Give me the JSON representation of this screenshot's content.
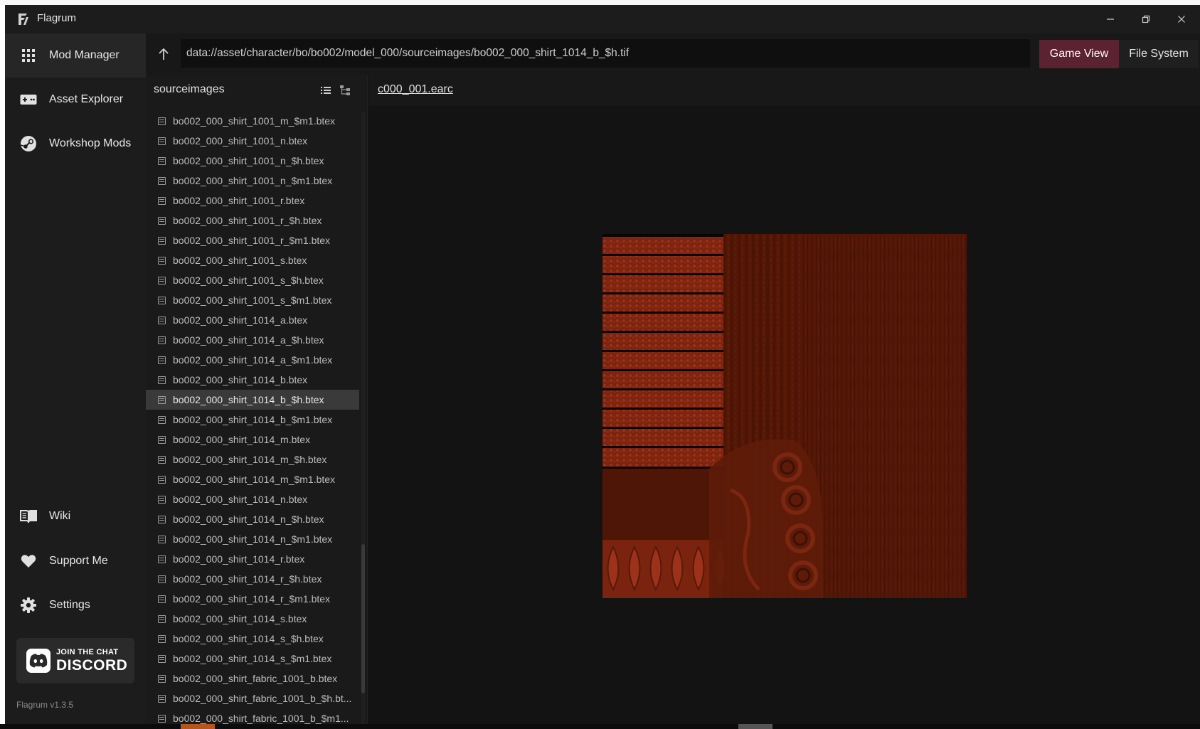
{
  "window": {
    "title": "Flagrum",
    "buttons": [
      "minimize-icon",
      "restore-icon",
      "close-icon"
    ]
  },
  "sidebar": {
    "items": [
      {
        "label": "Mod Manager",
        "icon": "grid-icon",
        "active": true
      },
      {
        "label": "Asset Explorer",
        "icon": "gamepad-icon",
        "active": false
      },
      {
        "label": "Workshop Mods",
        "icon": "steam-icon",
        "active": false
      }
    ],
    "bottom_items": [
      {
        "label": "Wiki",
        "icon": "book-icon"
      },
      {
        "label": "Support Me",
        "icon": "heart-icon"
      },
      {
        "label": "Settings",
        "icon": "gear-icon"
      }
    ],
    "discord": {
      "line1": "JOIN THE CHAT",
      "line2": "DISCORD"
    },
    "version": "Flagrum v1.3.5"
  },
  "address": {
    "path": "data://asset/character/bo/bo002/model_000/sourceimages/bo002_000_shirt_1014_b_$h.tif",
    "view_buttons": [
      "Game View",
      "File System"
    ],
    "active_view": "Game View"
  },
  "file_panel": {
    "title": "sourceimages",
    "selected_index": 14,
    "files": [
      "bo002_000_shirt_1001_m_$m1.btex",
      "bo002_000_shirt_1001_n.btex",
      "bo002_000_shirt_1001_n_$h.btex",
      "bo002_000_shirt_1001_n_$m1.btex",
      "bo002_000_shirt_1001_r.btex",
      "bo002_000_shirt_1001_r_$h.btex",
      "bo002_000_shirt_1001_r_$m1.btex",
      "bo002_000_shirt_1001_s.btex",
      "bo002_000_shirt_1001_s_$h.btex",
      "bo002_000_shirt_1001_s_$m1.btex",
      "bo002_000_shirt_1014_a.btex",
      "bo002_000_shirt_1014_a_$h.btex",
      "bo002_000_shirt_1014_a_$m1.btex",
      "bo002_000_shirt_1014_b.btex",
      "bo002_000_shirt_1014_b_$h.btex",
      "bo002_000_shirt_1014_b_$m1.btex",
      "bo002_000_shirt_1014_m.btex",
      "bo002_000_shirt_1014_m_$h.btex",
      "bo002_000_shirt_1014_m_$m1.btex",
      "bo002_000_shirt_1014_n.btex",
      "bo002_000_shirt_1014_n_$h.btex",
      "bo002_000_shirt_1014_n_$m1.btex",
      "bo002_000_shirt_1014_r.btex",
      "bo002_000_shirt_1014_r_$h.btex",
      "bo002_000_shirt_1014_r_$m1.btex",
      "bo002_000_shirt_1014_s.btex",
      "bo002_000_shirt_1014_s_$h.btex",
      "bo002_000_shirt_1014_s_$m1.btex",
      "bo002_000_shirt_fabric_1001_b.btex",
      "bo002_000_shirt_fabric_1001_b_$h.bt...",
      "bo002_000_shirt_fabric_1001_b_$m1..."
    ]
  },
  "viewer": {
    "tab": "c000_001.earc",
    "preview": "texture-preview"
  },
  "colors": {
    "accent": "#5b2231",
    "texture_base": "#5a1a08",
    "texture_highlight": "#a8341a"
  }
}
